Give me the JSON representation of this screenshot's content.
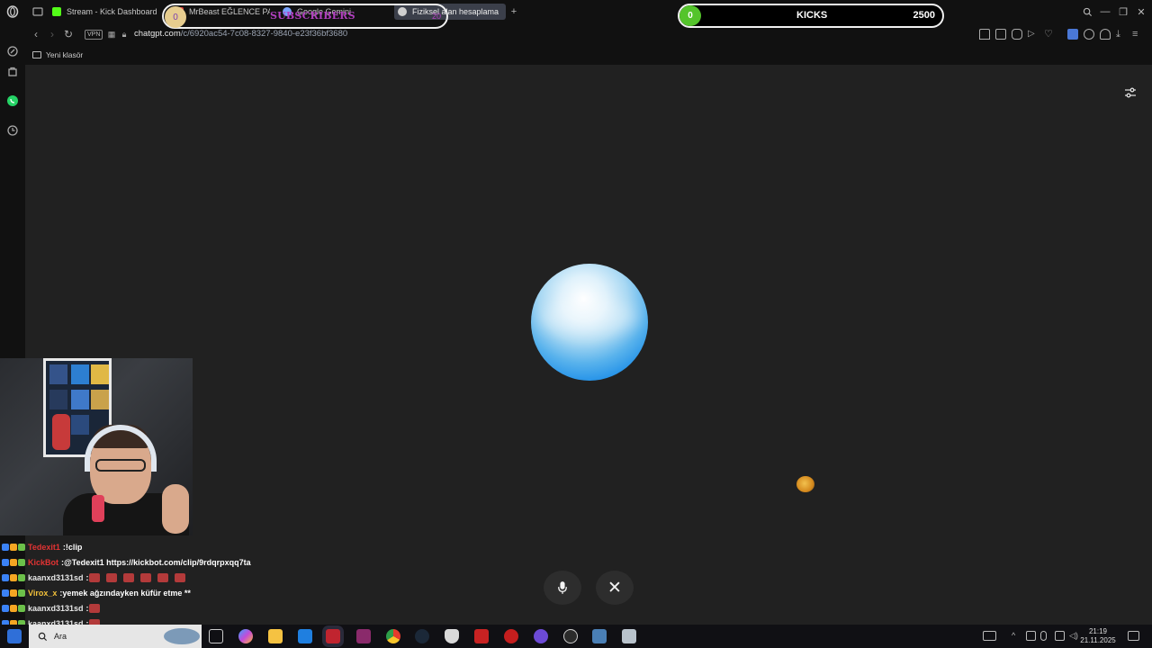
{
  "tabs": [
    {
      "label": "Stream - Kick Dashboard",
      "fav": "#53fc18"
    },
    {
      "label": "MrBeast EĞLENCE PAR",
      "fav": "#e23b3b"
    },
    {
      "label": "Google Gemini",
      "fav": "#7aa4ff"
    },
    {
      "label": "Fiziksel alan hesaplama",
      "fav": "#cfcfcf"
    }
  ],
  "address": {
    "vpn": "VPN",
    "host": "chatgpt.com",
    "path": "/c/6920ac54-7c08-8327-9840-e23f36bf3680"
  },
  "bookmarks": {
    "folder": "Yeni klasör"
  },
  "overlays": {
    "subs": {
      "count": "0",
      "label": "SUBSCRIBERS",
      "goal": "20"
    },
    "kicks": {
      "count": "0",
      "label": "KICKS",
      "goal": "2500"
    }
  },
  "voice": {
    "close_symbol": "✕"
  },
  "chat": [
    {
      "user": "Tedexit1",
      "sep": " : ",
      "msg": "!clip",
      "color": "#e23333",
      "emotes": 0
    },
    {
      "user": "KickBot",
      "sep": " : ",
      "msg": "@Tedexit1 https://kickbot.com/clip/9rdqrpxqq7ta",
      "color": "#e23333",
      "emotes": 0
    },
    {
      "user": "kaanxd3131sd",
      "sep": " : ",
      "msg": "",
      "color": "#e6e6e6",
      "emotes": 6
    },
    {
      "user": "Virox_x",
      "sep": " : ",
      "msg": "yemek ağzındayken küfür etme **",
      "color": "#f3c13a",
      "emotes": 0
    },
    {
      "user": "kaanxd3131sd",
      "sep": " : ",
      "msg": "",
      "color": "#e6e6e6",
      "emotes": 1
    },
    {
      "user": "kaanxd3131sd",
      "sep": " : ",
      "msg": "",
      "color": "#e6e6e6",
      "emotes": 1
    },
    {
      "user": "kaanxd3131sd",
      "sep": " : ",
      "msg": "",
      "color": "#e6e6e6",
      "emotes": 1
    }
  ],
  "taskbar": {
    "search_text": "Ara",
    "time": "21:19",
    "date": "21.11.2025"
  }
}
